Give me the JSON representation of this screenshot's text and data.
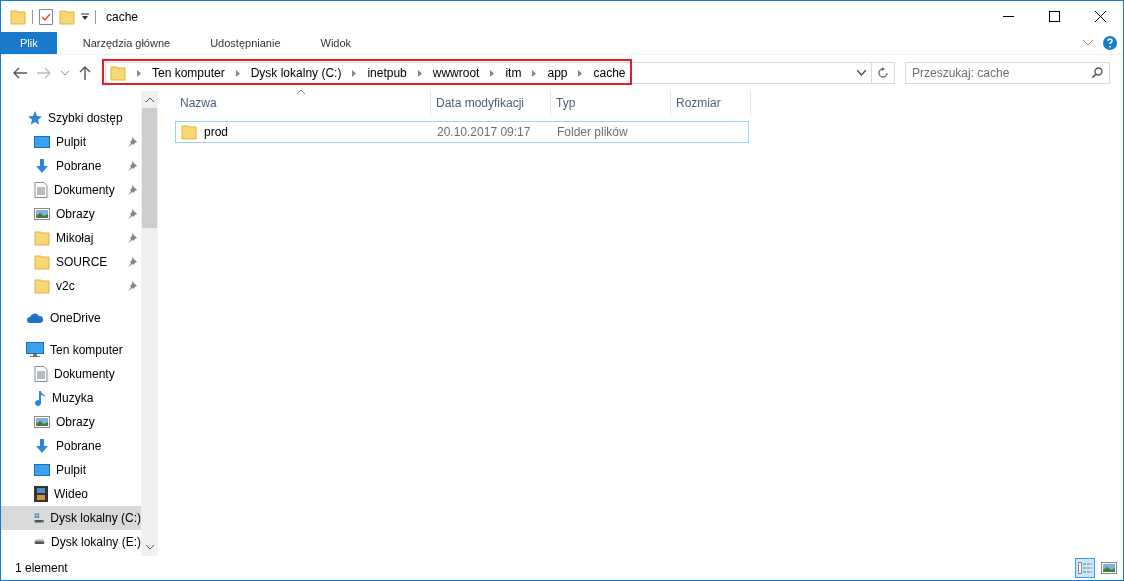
{
  "window": {
    "title": "cache"
  },
  "ribbon_tabs": [
    {
      "label": "Plik",
      "kind": "file"
    },
    {
      "label": "Narzędzia główne",
      "kind": "tab"
    },
    {
      "label": "Udostępnianie",
      "kind": "tab"
    },
    {
      "label": "Widok",
      "kind": "tab"
    }
  ],
  "address_bar": {
    "path": [
      "Ten komputer",
      "Dysk lokalny (C:)",
      "inetpub",
      "wwwroot",
      "itm",
      "app",
      "cache"
    ]
  },
  "search": {
    "placeholder": "Przeszukaj: cache"
  },
  "nav_tree": [
    {
      "label": "Szybki dostęp",
      "kind": "star",
      "selected": false,
      "children": [
        {
          "label": "Pulpit",
          "kind": "desktop",
          "pinned": true,
          "selected": false
        },
        {
          "label": "Pobrane",
          "kind": "download",
          "pinned": true,
          "selected": false
        },
        {
          "label": "Dokumenty",
          "kind": "document",
          "pinned": true,
          "selected": false
        },
        {
          "label": "Obrazy",
          "kind": "pictures",
          "pinned": true,
          "selected": false
        },
        {
          "label": "Mikołaj",
          "kind": "folder",
          "pinned": true,
          "selected": false
        },
        {
          "label": "SOURCE",
          "kind": "folder",
          "pinned": true,
          "selected": false
        },
        {
          "label": "v2c",
          "kind": "folder",
          "pinned": true,
          "selected": false
        }
      ]
    },
    {
      "label": "OneDrive",
      "kind": "cloud",
      "selected": false
    },
    {
      "label": "Ten komputer",
      "kind": "computer",
      "selected": false,
      "children": [
        {
          "label": "Dokumenty",
          "kind": "document",
          "pinned": false,
          "selected": false
        },
        {
          "label": "Muzyka",
          "kind": "music",
          "pinned": false,
          "selected": false
        },
        {
          "label": "Obrazy",
          "kind": "pictures",
          "pinned": false,
          "selected": false
        },
        {
          "label": "Pobrane",
          "kind": "download",
          "pinned": false,
          "selected": false
        },
        {
          "label": "Pulpit",
          "kind": "desktop",
          "pinned": false,
          "selected": false
        },
        {
          "label": "Wideo",
          "kind": "video",
          "pinned": false,
          "selected": false
        },
        {
          "label": "Dysk lokalny (C:)",
          "kind": "system-drive",
          "pinned": false,
          "selected": true
        },
        {
          "label": "Dysk lokalny (E:)",
          "kind": "drive",
          "pinned": false,
          "selected": false
        }
      ]
    }
  ],
  "file_list": {
    "columns": [
      "Nazwa",
      "Data modyfikacji",
      "Typ",
      "Rozmiar"
    ],
    "rows": [
      {
        "name": "prod",
        "modified": "20.10.2017 09:17",
        "type": "Folder plików",
        "focused": true
      }
    ]
  },
  "status_bar": {
    "count": "1 element"
  }
}
